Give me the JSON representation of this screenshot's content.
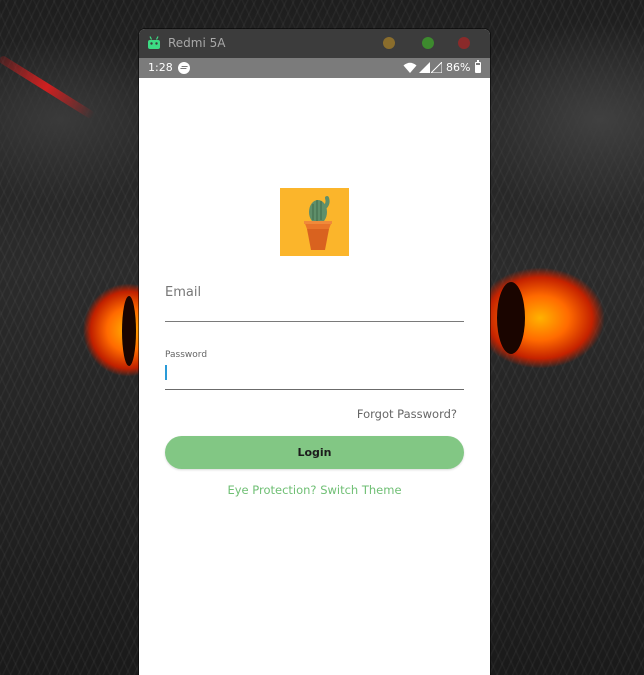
{
  "window": {
    "title": "Redmi 5A",
    "colors": {
      "titlebar": "#3c3c3c",
      "minimize": "#8a6d2c",
      "maximize": "#3d8a2e",
      "close": "#8a2a2a"
    }
  },
  "statusbar": {
    "time": "1:28",
    "battery": "86%",
    "icons": [
      "messenger-icon",
      "wifi-icon",
      "signal-icon",
      "signal-icon",
      "battery-icon"
    ]
  },
  "login": {
    "logo": "cactus-pot-icon",
    "email_label": "Email",
    "password_label": "Password",
    "password_value": "",
    "forgot_password": "Forgot Password?",
    "login_button": "Login",
    "theme_link": "Eye Protection? Switch Theme",
    "colors": {
      "accent": "#82c784",
      "link": "#6fbf74",
      "logo_bg": "#fbb52b",
      "caret": "#2a9bd8"
    }
  }
}
